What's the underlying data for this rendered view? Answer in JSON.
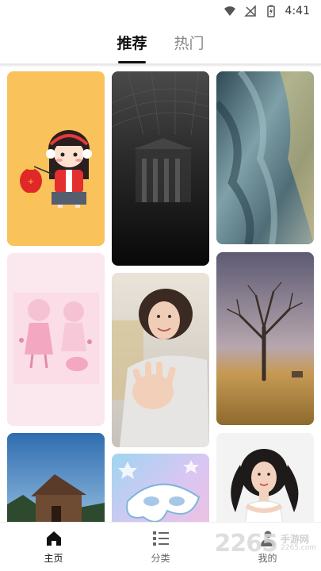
{
  "status_bar": {
    "time": "4:41"
  },
  "tabs": [
    {
      "label": "推荐",
      "active": true
    },
    {
      "label": "热门",
      "active": false
    }
  ],
  "wallpapers": [
    {
      "name": "wallpaper-cartoon-girl-lantern",
      "subject": "cartoon girl with lantern"
    },
    {
      "name": "wallpaper-dark-architecture",
      "subject": "dark architecture dome"
    },
    {
      "name": "wallpaper-blue-fabric",
      "subject": "blue abstract fabric"
    },
    {
      "name": "wallpaper-pink-sketch-girls",
      "subject": "pink sketch girls"
    },
    {
      "name": "wallpaper-woman-reaching-hand",
      "subject": "woman reaching hand"
    },
    {
      "name": "wallpaper-lone-tree-field",
      "subject": "lone tree in field"
    },
    {
      "name": "wallpaper-cabin-sky",
      "subject": "wooden cabin under sky"
    },
    {
      "name": "wallpaper-pastel-mask",
      "subject": "pastel mask"
    },
    {
      "name": "wallpaper-woman-white-dress",
      "subject": "woman in white dress"
    }
  ],
  "bottom_nav": [
    {
      "label": "主页",
      "icon": "home-icon",
      "active": true
    },
    {
      "label": "分类",
      "icon": "list-icon",
      "active": false
    },
    {
      "label": "我的",
      "icon": "user-icon",
      "active": false
    }
  ],
  "watermark": {
    "number": "2265",
    "cn": "手游网",
    "url": "2265.com"
  },
  "colors": {
    "accent": "#111111",
    "inactive": "#888888",
    "background": "#ffffff"
  }
}
